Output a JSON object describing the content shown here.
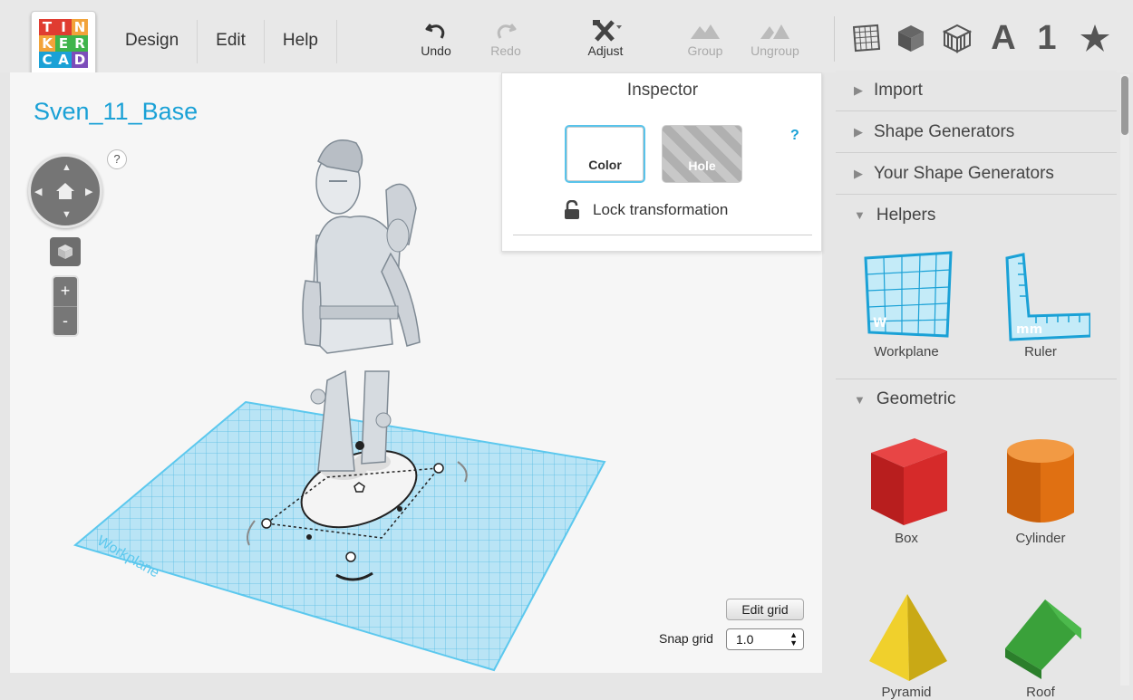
{
  "logo": {
    "letters": [
      "T",
      "I",
      "N",
      "K",
      "E",
      "R",
      "C",
      "A",
      "D"
    ],
    "colors": [
      "#e03c31",
      "#e03c31",
      "#f2a33a",
      "#f2a33a",
      "#3fb44b",
      "#3fb44b",
      "#1aa1d6",
      "#1aa1d6",
      "#7c4dba"
    ]
  },
  "menu": {
    "items": [
      "Design",
      "Edit",
      "Help"
    ]
  },
  "toolbar": {
    "undo": "Undo",
    "redo": "Redo",
    "adjust": "Adjust",
    "group": "Group",
    "ungroup": "Ungroup"
  },
  "view_controls": {
    "text_view": "A",
    "number_view": "1"
  },
  "design": {
    "title": "Sven_11_Base"
  },
  "help_mark": "?",
  "zoom": {
    "in": "+",
    "out": "-"
  },
  "inspector": {
    "title": "Inspector",
    "help": "?",
    "color_label": "Color",
    "hole_label": "Hole",
    "lock_label": "Lock transformation"
  },
  "workplane_label": "Workplane",
  "grid": {
    "edit_label": "Edit grid",
    "snap_label": "Snap grid",
    "snap_value": "1.0"
  },
  "sidebar": {
    "sections": [
      "Import",
      "Shape Generators",
      "Your Shape Generators",
      "Helpers",
      "Geometric"
    ],
    "helpers": [
      "Workplane",
      "Ruler"
    ],
    "geometric": [
      "Box",
      "Cylinder",
      "Pyramid",
      "Roof"
    ]
  },
  "colors": {
    "accent": "#1aa1d6",
    "grid": "#5cc8ee",
    "box": "#d62a2a",
    "cylinder": "#e87a18",
    "pyramid": "#e8c51a",
    "roof": "#3aa13a"
  }
}
